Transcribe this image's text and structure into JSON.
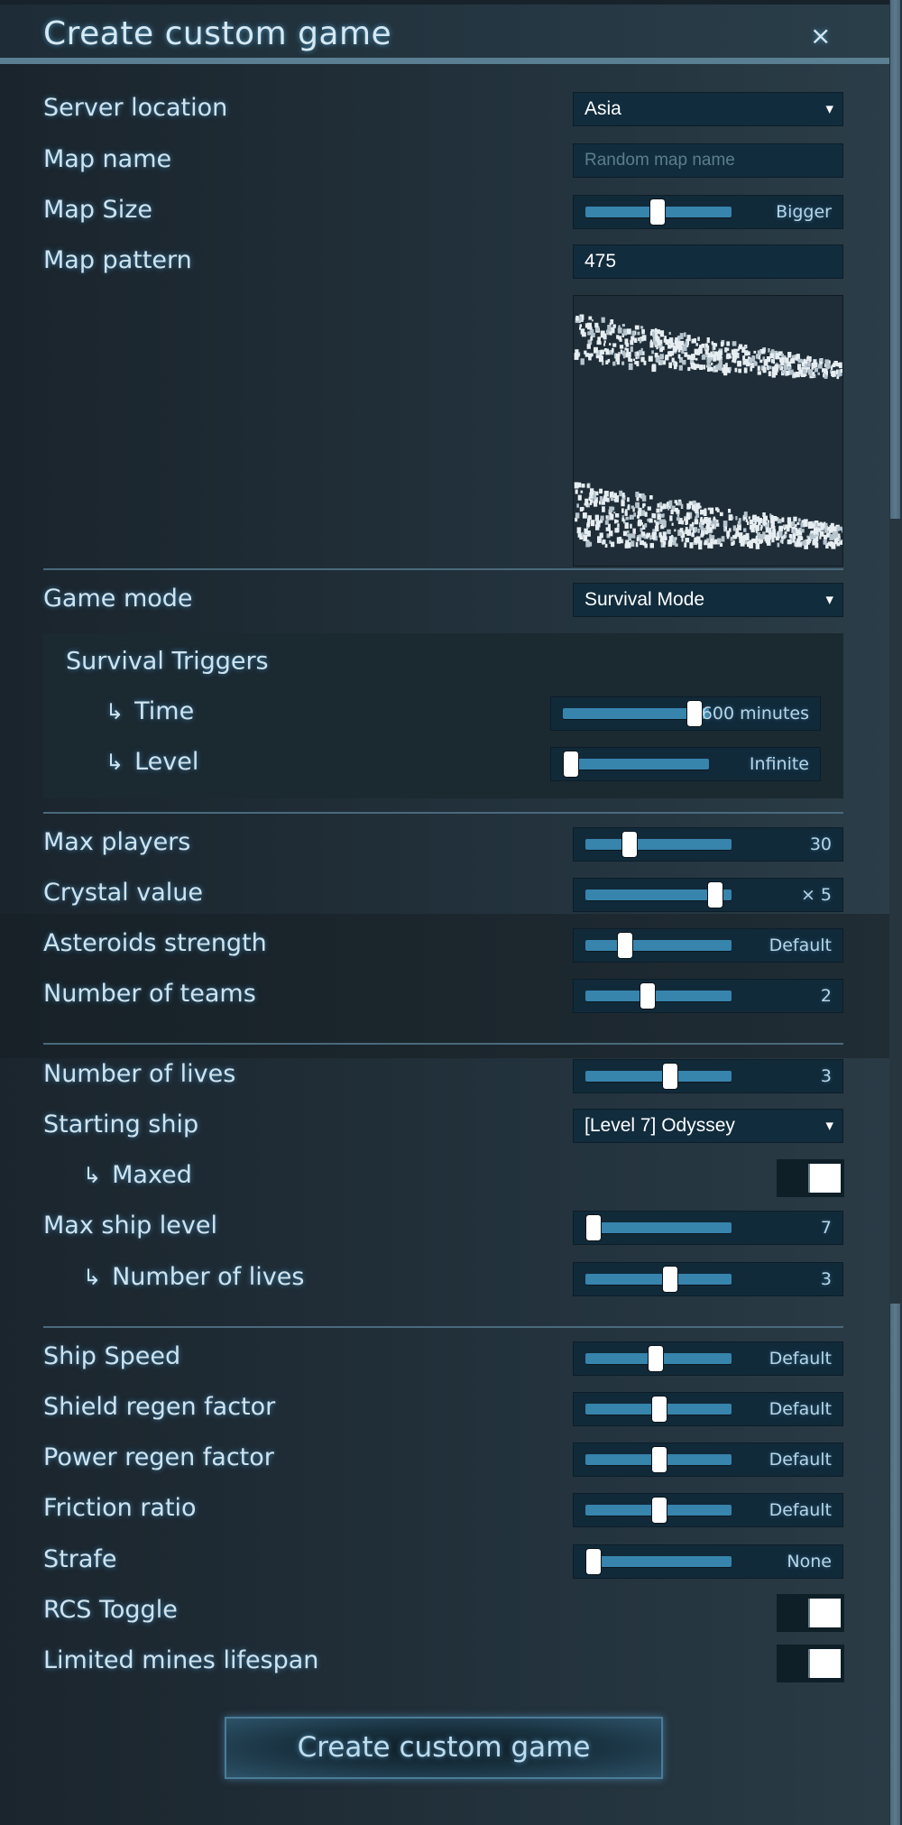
{
  "dialog": {
    "title": "Create custom game",
    "close_label": "×"
  },
  "settings": {
    "server_location": {
      "label": "Server location",
      "value": "Asia"
    },
    "map_name": {
      "label": "Map name",
      "value": "",
      "placeholder": "Random map name"
    },
    "map_size": {
      "label": "Map Size",
      "value": "Bigger",
      "fraction": 0.49
    },
    "map_pattern": {
      "label": "Map pattern",
      "value": "475"
    },
    "game_mode": {
      "label": "Game mode",
      "value": "Survival Mode"
    },
    "survival_triggers": {
      "title": "Survival Triggers",
      "time": {
        "label": "Time",
        "value": "600 minutes",
        "fraction": 0.95
      },
      "level": {
        "label": "Level",
        "value": "Infinite",
        "fraction": 0.0
      }
    },
    "max_players": {
      "label": "Max players",
      "value": "30",
      "fraction": 0.28
    },
    "crystal_value": {
      "label": "Crystal value",
      "value": "× 5",
      "fraction": 0.94
    },
    "asteroids_strength": {
      "label": "Asteroids strength",
      "value": "Default",
      "fraction": 0.24
    },
    "number_of_teams": {
      "label": "Number of teams",
      "value": "2",
      "fraction": 0.42
    },
    "number_of_lives": {
      "label": "Number of lives",
      "value": "3",
      "fraction": 0.59
    },
    "starting_ship": {
      "label": "Starting ship",
      "value": "[Level 7] Odyssey"
    },
    "maxed": {
      "label": "Maxed",
      "state": "right"
    },
    "max_ship_level": {
      "label": "Max ship level",
      "value": "7",
      "fraction": 0.0
    },
    "max_ship_lives": {
      "label": "Number of lives",
      "value": "3",
      "fraction": 0.59
    },
    "ship_speed": {
      "label": "Ship Speed",
      "value": "Default",
      "fraction": 0.48
    },
    "shield_regen": {
      "label": "Shield regen factor",
      "value": "Default",
      "fraction": 0.51
    },
    "power_regen": {
      "label": "Power regen factor",
      "value": "Default",
      "fraction": 0.51
    },
    "friction_ratio": {
      "label": "Friction ratio",
      "value": "Default",
      "fraction": 0.51
    },
    "strafe": {
      "label": "Strafe",
      "value": "None",
      "fraction": 0.0
    },
    "rcs_toggle": {
      "label": "RCS Toggle",
      "state": "right"
    },
    "limited_mines": {
      "label": "Limited mines lifespan",
      "state": "right"
    }
  },
  "icons": {
    "sub_arrow": "↳",
    "dropdown_caret": "▼"
  },
  "create_button": {
    "label": "Create custom game"
  },
  "colors": {
    "accent_line": "#5a7f92",
    "slider_track": "#3784ad",
    "field_bg": "#112c3d",
    "text": "#cfe3ee"
  }
}
